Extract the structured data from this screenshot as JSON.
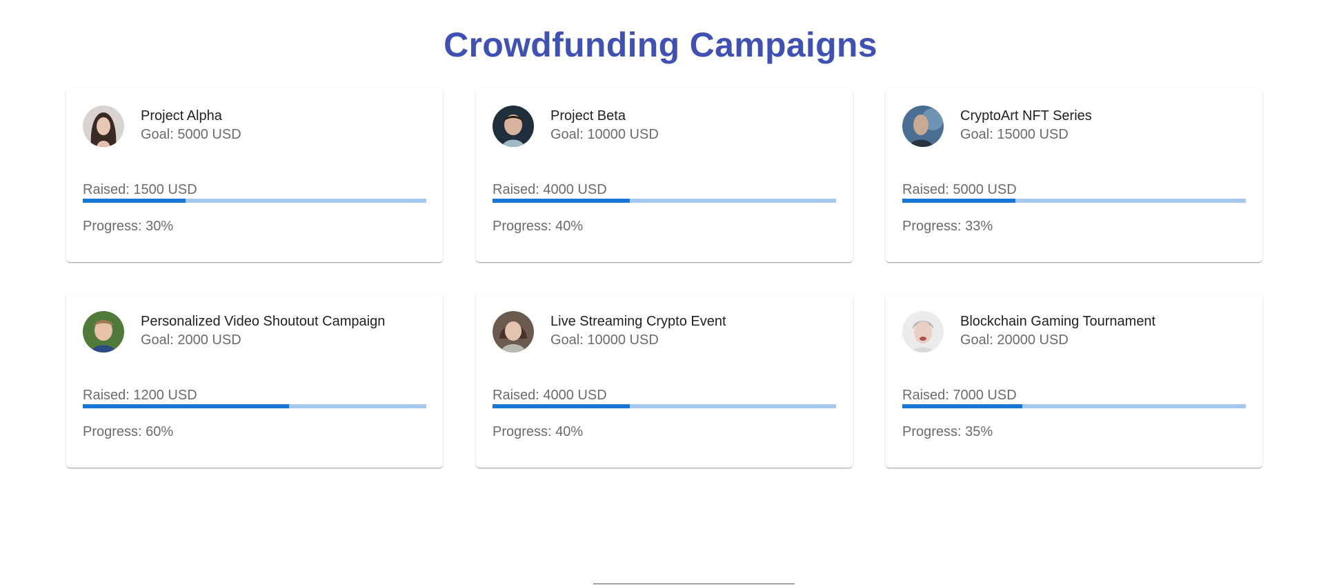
{
  "page": {
    "title": "Crowdfunding Campaigns",
    "title_color": "#3f51b5",
    "bar_color": "#1976d2",
    "bar_track_color": "#a6c8ef"
  },
  "campaigns": [
    {
      "name": "Project Alpha",
      "goal": "Goal: 5000 USD",
      "raised": "Raised: 1500 USD",
      "progress": "Progress: 30%",
      "progress_value": 0.3,
      "avatar": "woman-long-dark-hair-avatar"
    },
    {
      "name": "Project Beta",
      "goal": "Goal: 10000 USD",
      "raised": "Raised: 4000 USD",
      "progress": "Progress: 40%",
      "progress_value": 0.4,
      "avatar": "child-avatar"
    },
    {
      "name": "CryptoArt NFT Series",
      "goal": "Goal: 15000 USD",
      "raised": "Raised: 5000 USD",
      "progress": "Progress: 33%",
      "progress_value": 0.33,
      "avatar": "man-blue-background-avatar"
    },
    {
      "name": "Personalized Video Shoutout Campaign",
      "goal": "Goal: 2000 USD",
      "raised": "Raised: 1200 USD",
      "progress": "Progress: 60%",
      "progress_value": 0.6,
      "avatar": "boy-outdoors-avatar"
    },
    {
      "name": "Live Streaming Crypto Event",
      "goal": "Goal: 10000 USD",
      "raised": "Raised: 4000 USD",
      "progress": "Progress: 40%",
      "progress_value": 0.4,
      "avatar": "woman-scarf-avatar"
    },
    {
      "name": "Blockchain Gaming Tournament",
      "goal": "Goal: 20000 USD",
      "raised": "Raised: 7000 USD",
      "progress": "Progress: 35%",
      "progress_value": 0.35,
      "avatar": "man-grey-hair-avatar"
    }
  ]
}
